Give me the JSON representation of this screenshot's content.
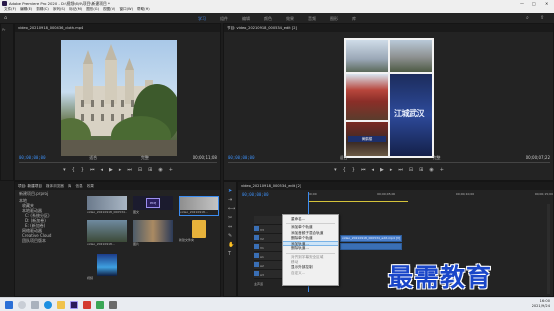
{
  "window": {
    "title": "Adobe Premiere Pro 2020 - D:\\视频\\6\\9\\项目\\新建项目 *"
  },
  "menu": [
    "文件(F)",
    "编辑(E)",
    "剪辑(C)",
    "序列(S)",
    "标记(M)",
    "图形(G)",
    "视图(V)",
    "窗口(W)",
    "帮助(H)"
  ],
  "workspace_tabs": [
    {
      "label": "学习",
      "active": true
    },
    {
      "label": "组件"
    },
    {
      "label": "编辑"
    },
    {
      "label": "颜色"
    },
    {
      "label": "效果"
    },
    {
      "label": "音频"
    },
    {
      "label": "图形"
    },
    {
      "label": "库"
    }
  ],
  "source_monitor": {
    "tab": "video_20210918_000436_cloth.mp4",
    "timecode_left": "00;00;00;00",
    "fit": "适合",
    "quality": "完整",
    "timecode_right": "00;00;11;08"
  },
  "program_monitor": {
    "tab": "节目: video_20210918_000534_edit [2]",
    "timecode_left": "00;00;00;00",
    "fit": "适合",
    "quality": "完整",
    "timecode_right": "00;00;07;22",
    "image_text": [
      "江城武汉",
      "黄鹤楼"
    ]
  },
  "project_panel": {
    "tabs": [
      "项目: 新建项目",
      "媒体浏览器",
      "库",
      "信息",
      "效果"
    ],
    "path": "新建项目.prproj",
    "tree": [
      "本地",
      "收藏夹",
      "本地驱动器",
      "C: (系统分区)",
      "D: (新加卷)",
      "E: (新加卷)",
      "网络驱动器",
      "Creative Cloud",
      "团队项目版本"
    ],
    "items": [
      {
        "label": "video_20210918_000534...",
        "kind": "video"
      },
      {
        "label": "图文",
        "kind": "prproj"
      },
      {
        "label": "video_20210918...",
        "kind": "video"
      },
      {
        "label": "video_20210918...",
        "kind": "video"
      },
      {
        "label": "图片",
        "kind": "video"
      },
      {
        "label": "新建文件夹",
        "kind": "folder"
      },
      {
        "label": "视频",
        "kind": "video"
      }
    ],
    "prproj_badge": "PRPJ"
  },
  "timeline": {
    "tab": "video_20210918_000534_edit [2]",
    "timecode": "00;00;00;00",
    "ruler": [
      "00;00",
      "00;00;05;00",
      "00;00;10;00",
      "00;00;15;00"
    ],
    "tracks": [
      "V3",
      "V2",
      "V1",
      "A1",
      "A2",
      "A3",
      "主声道"
    ],
    "clip_label": "video_20210918_000534_edit.mp4 [V]"
  },
  "context_menu": {
    "items": [
      {
        "label": "重命名...",
        "disabled": false
      },
      {
        "label": "添加单个轨道",
        "disabled": false
      },
      {
        "label": "添加音频子混合轨道",
        "disabled": false
      },
      {
        "label": "删除单个轨道",
        "disabled": false
      },
      {
        "label": "添加轨道...",
        "disabled": false,
        "highlighted": true
      },
      {
        "label": "删除轨道...",
        "disabled": false
      },
      {
        "label": "对齐到字幕安全区域",
        "disabled": true
      },
      {
        "label": "移动",
        "disabled": true
      },
      {
        "label": "显示外部控制",
        "disabled": false
      },
      {
        "label": "自定义...",
        "disabled": true
      }
    ]
  },
  "taskbar": {
    "time": "16:00",
    "date": "2021/9/24"
  },
  "watermark": "最需教育",
  "colors": {
    "accent": "#3b8cf1",
    "watermark": "#1a46c8"
  }
}
